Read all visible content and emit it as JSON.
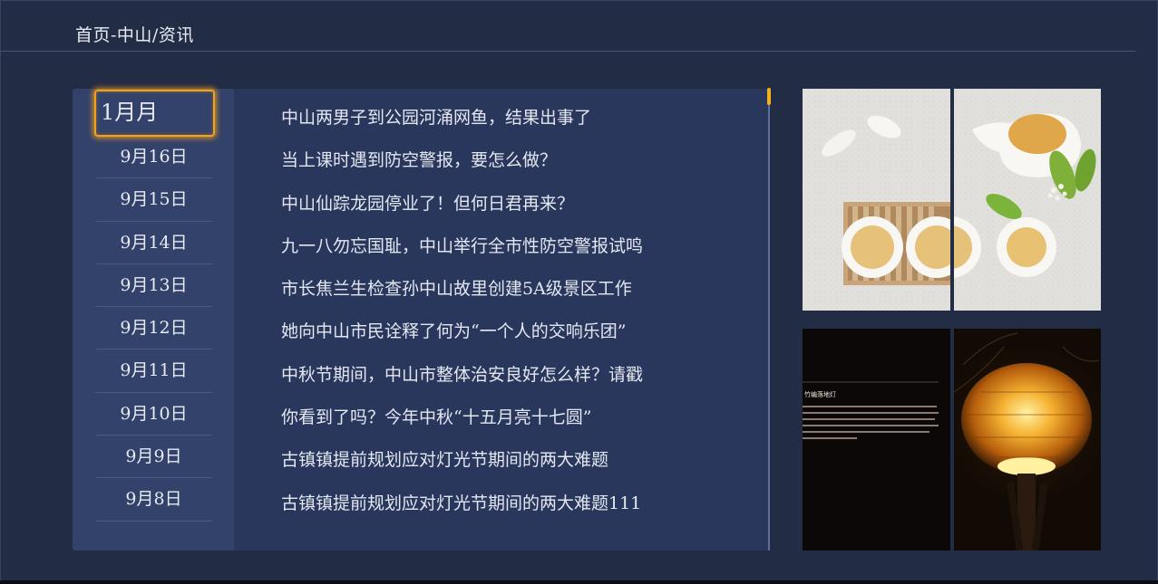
{
  "breadcrumb": "首页-中山/资讯",
  "dates": {
    "current": "1月月",
    "items": [
      "9月16日",
      "9月15日",
      "9月14日",
      "9月13日",
      "9月12日",
      "9月11日",
      "9月10日",
      "9月9日",
      "9月8日"
    ]
  },
  "articles": [
    "中山两男子到公园河涌网鱼，结果出事了",
    "当上课时遇到防空警报，要怎么做？",
    "中山仙踪龙园停业了！但何日君再来？",
    "九一八勿忘国耻，中山举行全市性防空警报试鸣",
    "市长焦兰生检查孙中山故里创建5A级景区工作",
    "她向中山市民诠释了何为“一个人的交响乐团”",
    "中秋节期间，中山市整体治安良好怎么样？请戳",
    "你看到了吗？今年中秋“十五月亮十七圆”",
    "古镇镇提前规划应对灯光节期间的两大难题",
    "古镇镇提前规划应对灯光节期间的两大难题111"
  ],
  "images": {
    "lamp_caption_title": "竹编落地灯"
  },
  "colors": {
    "background": "#232c45",
    "focus": "#f3a21a",
    "date_panel": "#33426a",
    "article_panel": "#2a375d"
  }
}
